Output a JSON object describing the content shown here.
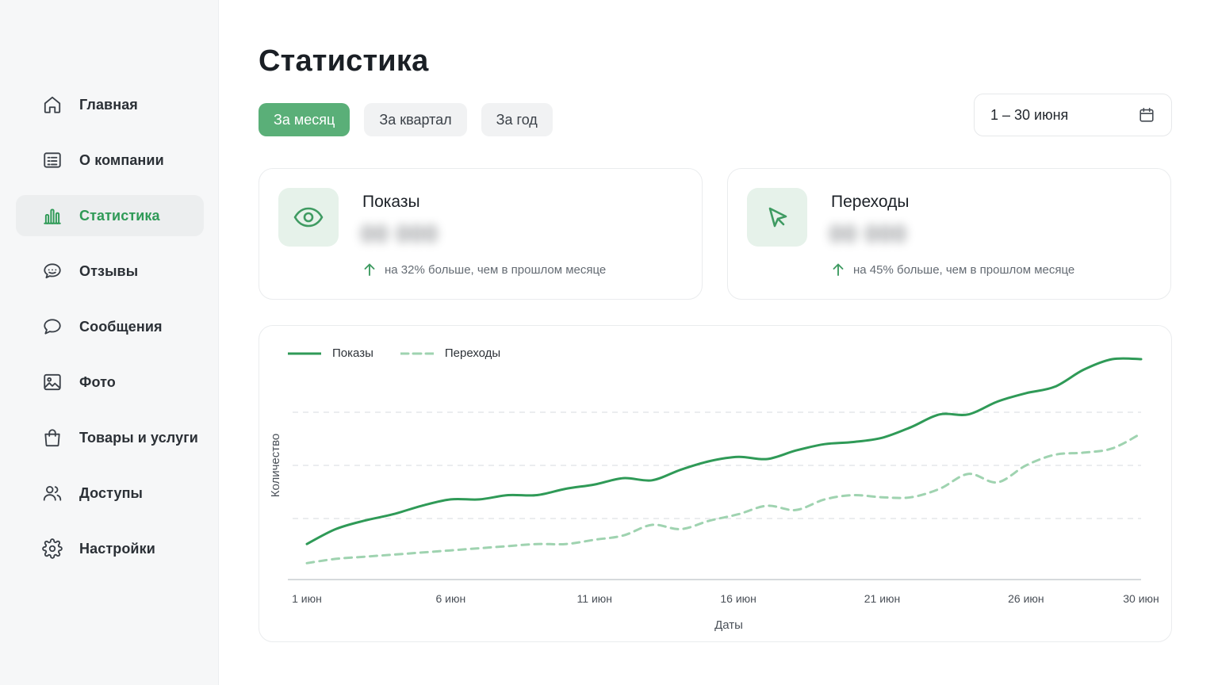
{
  "sidebar": {
    "items": [
      {
        "label": "Главная",
        "icon": "home-icon",
        "active": false
      },
      {
        "label": "О компании",
        "icon": "document-list-icon",
        "active": false
      },
      {
        "label": "Статистика",
        "icon": "bar-chart-icon",
        "active": true
      },
      {
        "label": "Отзывы",
        "icon": "review-chat-icon",
        "active": false
      },
      {
        "label": "Сообщения",
        "icon": "message-bubble-icon",
        "active": false
      },
      {
        "label": "Фото",
        "icon": "image-icon",
        "active": false
      },
      {
        "label": "Товары и услуги",
        "icon": "shopping-bag-icon",
        "active": false
      },
      {
        "label": "Доступы",
        "icon": "users-icon",
        "active": false
      },
      {
        "label": "Настройки",
        "icon": "gear-icon",
        "active": false
      }
    ]
  },
  "header": {
    "title": "Статистика"
  },
  "period_tabs": [
    {
      "label": "За месяц",
      "active": true
    },
    {
      "label": "За квартал",
      "active": false
    },
    {
      "label": "За год",
      "active": false
    }
  ],
  "date_range": {
    "value": "1 – 30 июня",
    "icon": "calendar-icon"
  },
  "stats": {
    "views": {
      "title": "Показы",
      "value": "00 000",
      "delta": "на 32% больше, чем в прошлом месяце",
      "icon": "eye-icon"
    },
    "clicks": {
      "title": "Переходы",
      "value": "00 000",
      "delta": "на 45% больше, чем в прошлом месяце",
      "icon": "cursor-icon"
    }
  },
  "colors": {
    "accent": "#2f9a57",
    "accent_button": "#5aaf78",
    "accent_soft": "#e6f2ea",
    "series_secondary": "#9fd3b0"
  },
  "chart_data": {
    "type": "line",
    "xlabel": "Даты",
    "ylabel": "Количество",
    "x_ticks": [
      "1 июн",
      "6 июн",
      "11 июн",
      "16 июн",
      "21 июн",
      "26 июн",
      "30 июн"
    ],
    "x": [
      1,
      2,
      3,
      4,
      5,
      6,
      7,
      8,
      9,
      10,
      11,
      12,
      13,
      14,
      15,
      16,
      17,
      18,
      19,
      20,
      21,
      22,
      23,
      24,
      25,
      26,
      27,
      28,
      29,
      30
    ],
    "ylim": [
      0,
      100
    ],
    "grid": true,
    "legend_position": "top-left",
    "series": [
      {
        "name": "Показы",
        "style": "solid",
        "values": [
          13,
          20,
          24,
          27,
          31,
          34,
          34,
          36,
          36,
          39,
          41,
          44,
          43,
          48,
          52,
          54,
          53,
          57,
          60,
          61,
          63,
          68,
          74,
          74,
          80,
          84,
          87,
          95,
          100,
          100
        ]
      },
      {
        "name": "Переходы",
        "style": "dashed",
        "values": [
          4,
          6,
          7,
          8,
          9,
          10,
          11,
          12,
          13,
          13,
          15,
          17,
          22,
          20,
          24,
          27,
          31,
          29,
          34,
          36,
          35,
          35,
          39,
          46,
          42,
          50,
          55,
          56,
          58,
          65
        ]
      }
    ]
  }
}
